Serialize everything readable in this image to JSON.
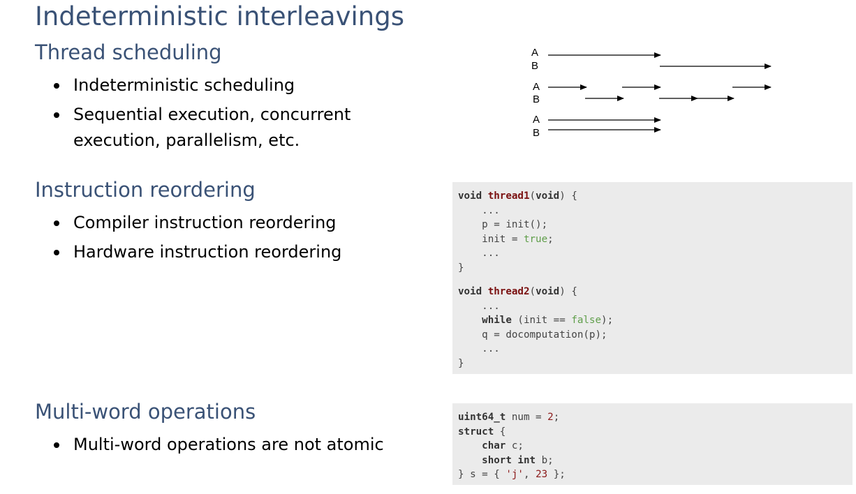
{
  "title": "Indeterministic interleavings",
  "sections": {
    "scheduling": {
      "heading": "Thread scheduling",
      "bullets": [
        "Indeterministic scheduling",
        "Sequential execution, concurrent execution, parallelism, etc."
      ]
    },
    "reordering": {
      "heading": "Instruction reordering",
      "bullets": [
        "Compiler instruction reordering",
        "Hardware instruction reordering"
      ]
    },
    "multiword": {
      "heading": "Multi-word operations",
      "bullets": [
        "Multi-word operations are not atomic"
      ]
    }
  },
  "diagram": {
    "labels": [
      "A",
      "B",
      "A",
      "B",
      "A",
      "B"
    ]
  },
  "code1": {
    "t1_kw_void": "void",
    "t1_name": "thread1",
    "t1_paren_void": "void",
    "t1_dots1": "...",
    "t1_assign": "p = init();",
    "t1_init": "init = ",
    "t1_true": "true",
    "t1_dots2": "...",
    "t1_close": "}",
    "t2_kw_void": "void",
    "t2_name": "thread2",
    "t2_paren_void": "void",
    "t2_dots1": "...",
    "t2_while": "while",
    "t2_cond": " (init == ",
    "t2_false": "false",
    "t2_comp": "q = docomputation(p);",
    "t2_dots2": "...",
    "t2_close": "}"
  },
  "code2": {
    "type": "uint64_t",
    "decl": " num = ",
    "val": "2",
    "struct": "struct",
    "char": "char",
    "char_field": " c;",
    "short_int": "short int",
    "short_field": " b;",
    "init_open": "} s = { ",
    "init_char": "'j'",
    "init_sep": ", ",
    "init_num": "23",
    "init_close": " };"
  }
}
